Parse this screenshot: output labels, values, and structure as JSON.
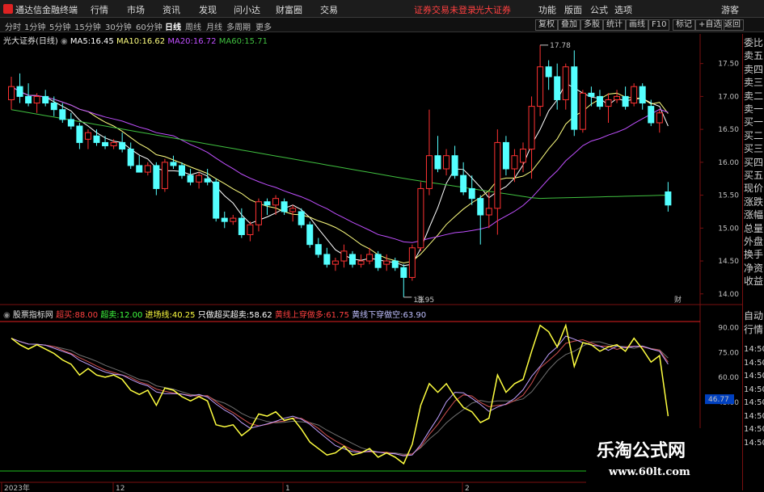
{
  "menu": {
    "app_name": "通达信金融终端",
    "items": [
      "行情",
      "市场",
      "资讯",
      "发现",
      "问小达",
      "财富圈",
      "交易"
    ],
    "status": "证券交易未登录",
    "broker": "光大证券",
    "right": [
      "功能",
      "版面",
      "公式",
      "选项"
    ],
    "guest": "游客"
  },
  "toolbar": {
    "timeframes": [
      "分时",
      "1分钟",
      "5分钟",
      "15分钟",
      "30分钟",
      "60分钟",
      "日线",
      "周线",
      "月线",
      "多周期",
      "更多"
    ],
    "active": "日线",
    "tools": [
      "复权",
      "叠加",
      "多股",
      "统计",
      "画线",
      "F10",
      "标记",
      "+自选",
      "返回"
    ]
  },
  "stock": {
    "name": "光大证券(日线)",
    "ma": [
      {
        "label": "MA5:",
        "value": "16.45",
        "color": "#ffffff"
      },
      {
        "label": "MA10:",
        "value": "16.62",
        "color": "#ffff80"
      },
      {
        "label": "MA20:",
        "value": "16.72",
        "color": "#c050ff"
      },
      {
        "label": "MA60:",
        "value": "15.71",
        "color": "#40c040"
      }
    ]
  },
  "indicator": {
    "name": "股票指标网",
    "params": [
      {
        "label": "超买:",
        "value": "88.00",
        "lc": "#ff4040"
      },
      {
        "label": "超卖:",
        "value": "12.00",
        "lc": "#40ff40"
      },
      {
        "label": "进场线:",
        "value": "40.25",
        "lc": "#ffff40"
      },
      {
        "label": "只做超买超卖:",
        "value": "58.62",
        "lc": "#ffffff"
      },
      {
        "label": "黄线上穿做多:",
        "value": "61.75",
        "lc": "#ff4040"
      },
      {
        "label": "黄线下穿做空:",
        "value": "63.90",
        "lc": "#c0c0ff"
      }
    ]
  },
  "price_axis": [
    "17.50",
    "17.00",
    "16.50",
    "16.00",
    "15.50",
    "15.00",
    "14.50",
    "14.00"
  ],
  "ind_axis": [
    "90.00",
    "75.00",
    "60.00",
    "45.00"
  ],
  "ind_current": "46.77",
  "annotations": {
    "high": "17.78",
    "low": "13.95",
    "rise_mark": "涨",
    "fin_mark": "财"
  },
  "date_axis": [
    "2023年",
    "12",
    "1",
    "2"
  ],
  "right_panel": [
    "委比",
    "卖五",
    "卖四",
    "卖三",
    "卖二",
    "卖一",
    "买一",
    "买二",
    "买三",
    "买四",
    "买五",
    "现价",
    "涨跌",
    "涨幅",
    "总量",
    "外盘",
    "换手",
    "净资",
    "收益",
    "自动",
    "行情",
    "14:50",
    "14:50",
    "14:50",
    "14:50",
    "14:50",
    "14:50",
    "14:50",
    "14:50"
  ],
  "watermark": {
    "title": "乐淘公式网",
    "url": "www.60lt.com"
  },
  "chart_data": {
    "type": "candlestick",
    "ylim": [
      13.85,
      17.95
    ],
    "candles": [
      [
        16.95,
        17.3,
        16.8,
        17.15
      ],
      [
        17.15,
        17.35,
        16.9,
        17.0
      ],
      [
        17.0,
        17.2,
        16.85,
        16.9
      ],
      [
        16.9,
        17.05,
        16.75,
        17.0
      ],
      [
        17.0,
        17.1,
        16.85,
        16.9
      ],
      [
        16.9,
        17.0,
        16.7,
        16.8
      ],
      [
        16.8,
        16.9,
        16.6,
        16.65
      ],
      [
        16.65,
        16.75,
        16.5,
        16.55
      ],
      [
        16.55,
        16.6,
        16.2,
        16.3
      ],
      [
        16.35,
        16.5,
        16.2,
        16.45
      ],
      [
        16.4,
        16.5,
        16.25,
        16.3
      ],
      [
        16.3,
        16.4,
        16.2,
        16.25
      ],
      [
        16.25,
        16.35,
        16.2,
        16.3
      ],
      [
        16.3,
        16.45,
        16.15,
        16.2
      ],
      [
        16.2,
        16.3,
        15.9,
        15.95
      ],
      [
        15.95,
        16.1,
        15.85,
        15.85
      ],
      [
        15.85,
        16.0,
        15.8,
        15.95
      ],
      [
        15.95,
        16.0,
        15.5,
        15.6
      ],
      [
        15.6,
        16.05,
        15.55,
        16.0
      ],
      [
        16.0,
        16.1,
        15.9,
        15.95
      ],
      [
        15.95,
        16.0,
        15.75,
        15.8
      ],
      [
        15.8,
        15.9,
        15.65,
        15.7
      ],
      [
        15.7,
        15.85,
        15.6,
        15.8
      ],
      [
        15.75,
        15.9,
        15.65,
        15.7
      ],
      [
        15.7,
        15.75,
        15.1,
        15.15
      ],
      [
        15.15,
        15.25,
        15.0,
        15.1
      ],
      [
        15.1,
        15.2,
        15.05,
        15.15
      ],
      [
        15.15,
        15.3,
        14.85,
        14.9
      ],
      [
        14.9,
        15.1,
        14.8,
        15.05
      ],
      [
        15.05,
        15.45,
        14.95,
        15.4
      ],
      [
        15.4,
        15.45,
        15.2,
        15.35
      ],
      [
        15.35,
        15.5,
        15.2,
        15.45
      ],
      [
        15.4,
        15.45,
        15.2,
        15.25
      ],
      [
        15.25,
        15.35,
        15.1,
        15.3
      ],
      [
        15.25,
        15.3,
        15.0,
        15.05
      ],
      [
        15.05,
        15.1,
        14.7,
        14.75
      ],
      [
        14.75,
        14.85,
        14.55,
        14.6
      ],
      [
        14.6,
        14.7,
        14.4,
        14.45
      ],
      [
        14.45,
        14.55,
        14.35,
        14.5
      ],
      [
        14.5,
        14.75,
        14.4,
        14.65
      ],
      [
        14.6,
        14.65,
        14.4,
        14.45
      ],
      [
        14.45,
        14.6,
        14.4,
        14.5
      ],
      [
        14.5,
        14.7,
        14.45,
        14.6
      ],
      [
        14.6,
        14.65,
        14.35,
        14.4
      ],
      [
        14.45,
        14.6,
        14.35,
        14.5
      ],
      [
        14.5,
        14.55,
        14.35,
        14.4
      ],
      [
        14.4,
        14.45,
        13.95,
        14.25
      ],
      [
        14.25,
        14.75,
        14.2,
        14.7
      ],
      [
        14.7,
        15.7,
        14.65,
        15.6
      ],
      [
        15.6,
        16.8,
        15.5,
        16.1
      ],
      [
        16.1,
        16.4,
        15.85,
        15.9
      ],
      [
        15.9,
        16.2,
        15.8,
        16.1
      ],
      [
        16.1,
        16.25,
        15.75,
        15.8
      ],
      [
        15.8,
        16.0,
        15.5,
        15.55
      ],
      [
        15.6,
        15.8,
        15.35,
        15.45
      ],
      [
        15.45,
        15.5,
        14.75,
        15.2
      ],
      [
        15.2,
        15.55,
        15.0,
        15.3
      ],
      [
        15.3,
        16.5,
        14.9,
        16.3
      ],
      [
        16.3,
        16.4,
        15.8,
        15.9
      ],
      [
        15.9,
        16.2,
        15.7,
        16.1
      ],
      [
        16.0,
        16.3,
        15.85,
        16.2
      ],
      [
        16.2,
        17.0,
        15.75,
        16.85
      ],
      [
        16.85,
        17.78,
        16.7,
        17.45
      ],
      [
        17.45,
        17.55,
        17.1,
        17.3
      ],
      [
        17.3,
        17.5,
        16.8,
        16.95
      ],
      [
        16.95,
        17.5,
        16.8,
        17.45
      ],
      [
        17.45,
        17.7,
        16.4,
        16.5
      ],
      [
        16.5,
        17.1,
        16.45,
        17.05
      ],
      [
        17.05,
        17.15,
        16.85,
        17.0
      ],
      [
        17.0,
        17.1,
        16.8,
        16.85
      ],
      [
        16.85,
        17.05,
        16.6,
        16.95
      ],
      [
        16.95,
        17.1,
        16.9,
        17.0
      ],
      [
        17.0,
        17.15,
        16.8,
        16.85
      ],
      [
        16.9,
        17.2,
        16.85,
        17.15
      ],
      [
        17.15,
        17.2,
        16.8,
        16.9
      ],
      [
        16.85,
        16.95,
        16.55,
        16.6
      ],
      [
        16.6,
        16.8,
        16.45,
        16.75
      ],
      [
        15.55,
        15.7,
        15.25,
        15.35
      ]
    ]
  }
}
